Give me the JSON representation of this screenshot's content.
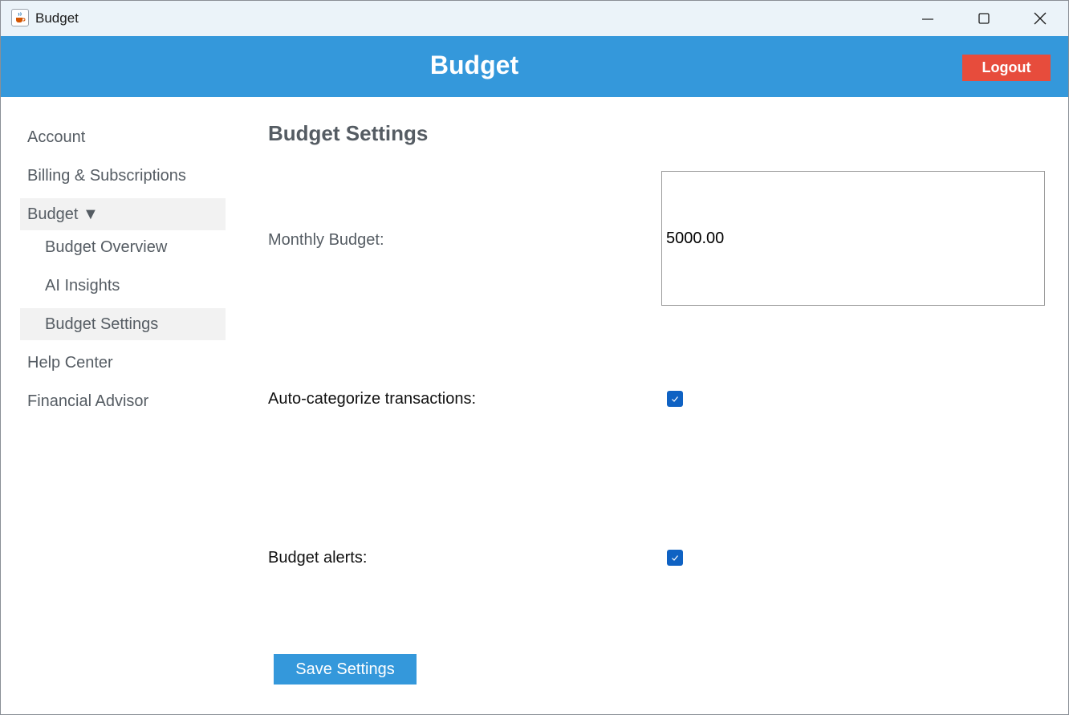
{
  "window": {
    "title": "Budget",
    "icon": "java-cup-icon",
    "controls": [
      "minimize-icon",
      "maximize-icon",
      "close-icon"
    ]
  },
  "header": {
    "title": "Budget",
    "logout_label": "Logout",
    "background_color": "#3498db",
    "logout_color": "#e74c3c"
  },
  "sidebar": {
    "items": [
      {
        "label": "Account",
        "level": 0,
        "active": false
      },
      {
        "label": "Billing & Subscriptions",
        "level": 0,
        "active": false
      },
      {
        "label": "Budget ▼",
        "level": 0,
        "active": true,
        "expanded": true
      },
      {
        "label": "Budget Overview",
        "level": 1,
        "active": false
      },
      {
        "label": "AI Insights",
        "level": 1,
        "active": false
      },
      {
        "label": "Budget Settings",
        "level": 1,
        "active": true
      },
      {
        "label": "Help Center",
        "level": 0,
        "active": false
      },
      {
        "label": "Financial Advisor",
        "level": 0,
        "active": false
      }
    ]
  },
  "main": {
    "title": "Budget Settings",
    "monthly_budget": {
      "label": "Monthly Budget:",
      "value": "5000.00"
    },
    "auto_categorize": {
      "label": "Auto-categorize transactions:",
      "checked": true
    },
    "budget_alerts": {
      "label": "Budget alerts:",
      "checked": true
    },
    "save_label": "Save Settings"
  }
}
